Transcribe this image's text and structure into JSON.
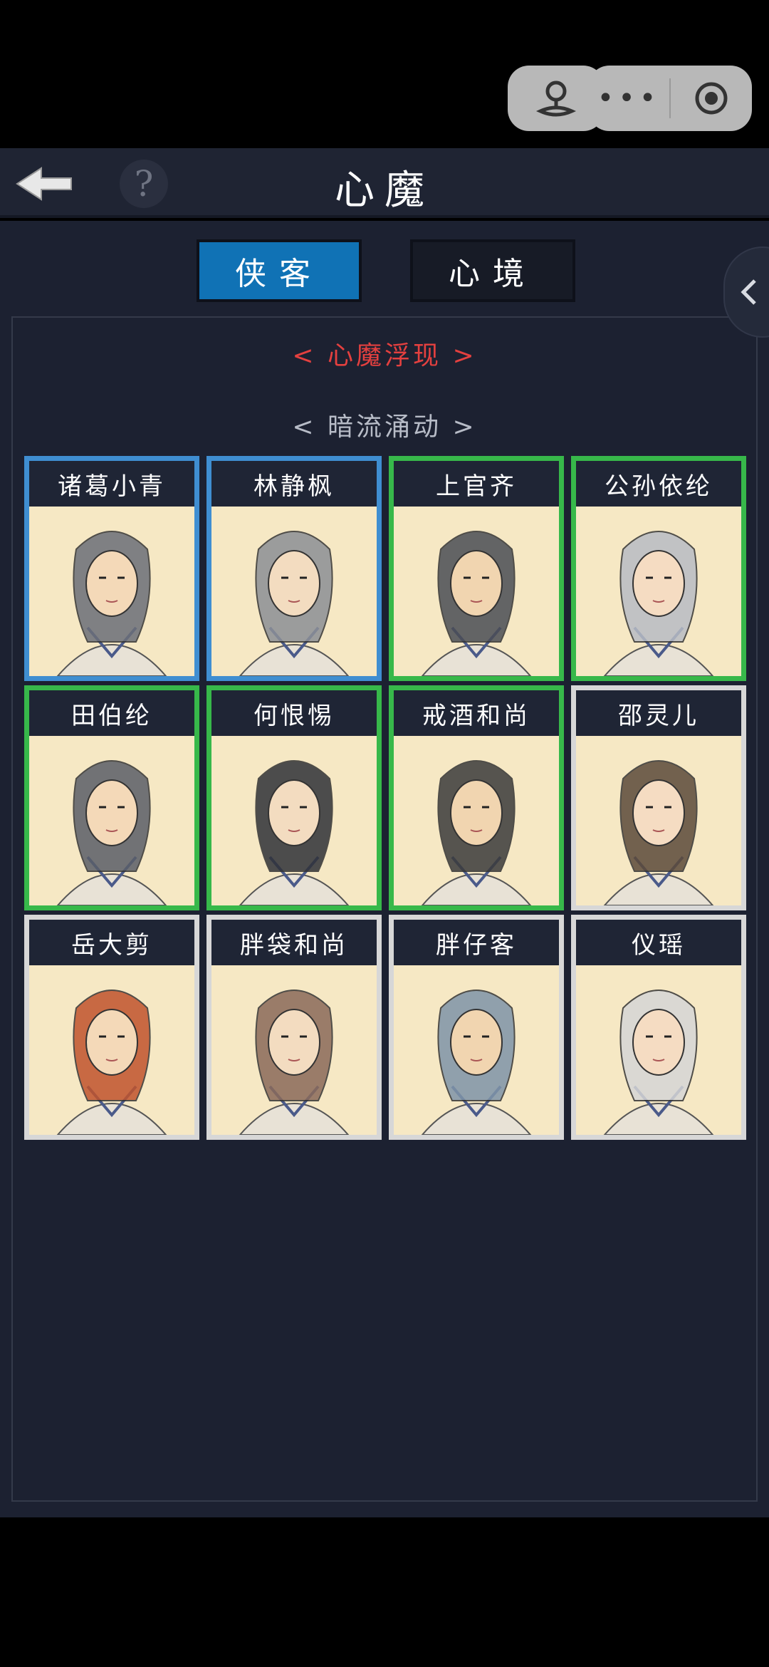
{
  "header": {
    "title": "心魔"
  },
  "tabs": [
    {
      "label": "侠客"
    },
    {
      "label": "心境"
    }
  ],
  "headings": {
    "red": "< 心魔浮现 >",
    "gray": "< 暗流涌动 >"
  },
  "colors": {
    "blue_border": "#3f8ed1",
    "green_border": "#37b84a",
    "white_border": "#d7d7d7",
    "tab_active": "#1072b5",
    "heading_red": "#e4403f"
  },
  "cards": [
    {
      "name": "诸葛小青",
      "border": "blue"
    },
    {
      "name": "林静枫",
      "border": "blue"
    },
    {
      "name": "上官齐",
      "border": "green"
    },
    {
      "name": "公孙依纶",
      "border": "green"
    },
    {
      "name": "田伯纶",
      "border": "green"
    },
    {
      "name": "何恨惕",
      "border": "green"
    },
    {
      "name": "戒酒和尚",
      "border": "green"
    },
    {
      "name": "邵灵儿",
      "border": "white"
    },
    {
      "name": "岳大剪",
      "border": "white"
    },
    {
      "name": "胖袋和尚",
      "border": "white"
    },
    {
      "name": "胖仔客",
      "border": "white"
    },
    {
      "name": "仪瑶",
      "border": "white"
    }
  ]
}
